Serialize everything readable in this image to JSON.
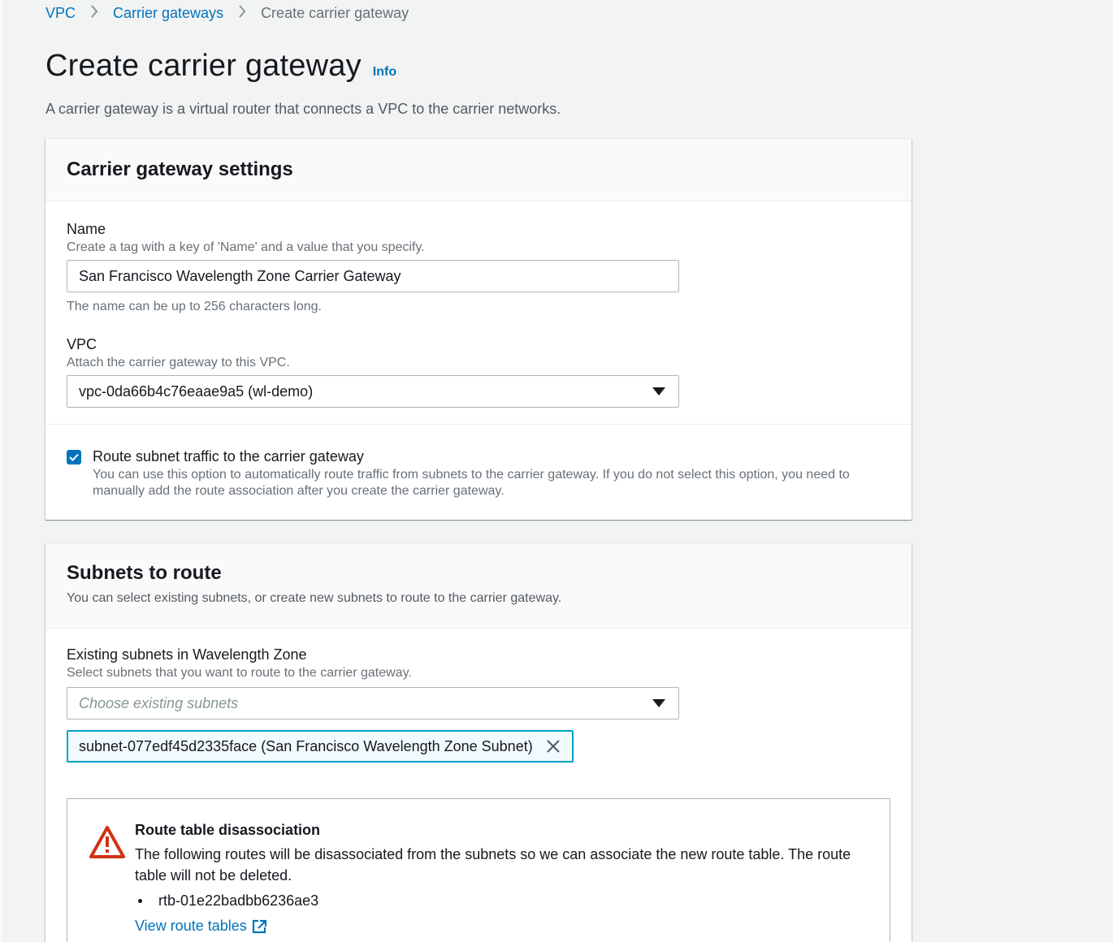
{
  "breadcrumb": {
    "items": [
      {
        "label": "VPC"
      },
      {
        "label": "Carrier gateways"
      },
      {
        "label": "Create carrier gateway"
      }
    ]
  },
  "header": {
    "title": "Create carrier gateway",
    "info_label": "Info",
    "description": "A carrier gateway is a virtual router that connects a VPC to the carrier networks."
  },
  "settings": {
    "title": "Carrier gateway settings",
    "name": {
      "label": "Name",
      "description": "Create a tag with a key of 'Name' and a value that you specify.",
      "value": "San Francisco Wavelength Zone Carrier Gateway",
      "hint": "The name can be up to 256 characters long."
    },
    "vpc": {
      "label": "VPC",
      "description": "Attach the carrier gateway to this VPC.",
      "value": "vpc-0da66b4c76eaae9a5 (wl-demo)"
    },
    "route": {
      "checked": true,
      "label": "Route subnet traffic to the carrier gateway",
      "description": "You can use this option to automatically route traffic from subnets to the carrier gateway. If you do not select this option, you need to manually add the route association after you create the carrier gateway."
    }
  },
  "subnets": {
    "title": "Subnets to route",
    "description": "You can select existing subnets, or create new subnets to route to the carrier gateway.",
    "existing": {
      "label": "Existing subnets in Wavelength Zone",
      "description": "Select subnets that you want to route to the carrier gateway.",
      "placeholder": "Choose existing subnets",
      "tokens": [
        {
          "label": "subnet-077edf45d2335face (San Francisco Wavelength Zone Subnet)"
        }
      ]
    },
    "alert": {
      "title": "Route table disassociation",
      "body": "The following routes will be disassociated from the subnets so we can associate the new route table. The route table will not be deleted.",
      "routes": [
        "rtb-01e22badbb6236ae3"
      ],
      "link_label": "View route tables"
    }
  },
  "colors": {
    "link": "#0073bb",
    "warning": "#d13212",
    "token_border": "#00a1c9"
  }
}
